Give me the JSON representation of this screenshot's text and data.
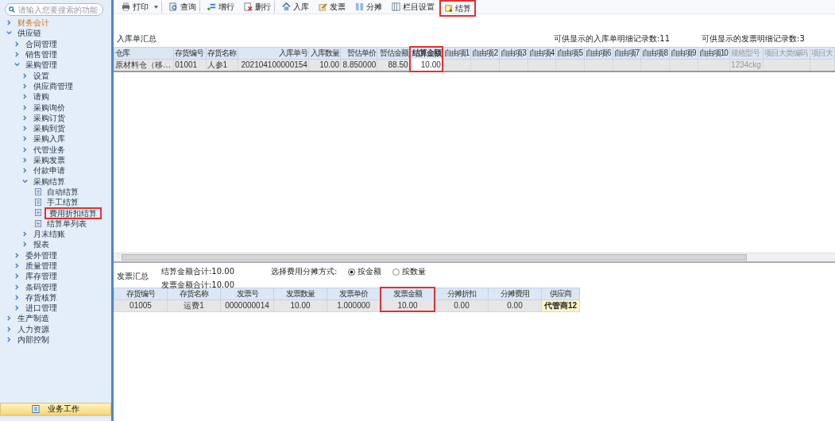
{
  "sidebar": {
    "search": {
      "placeholder": "请输入您要搜索的功能"
    },
    "tree": [
      {
        "label": "财务会计",
        "kind": "folder",
        "expanded": false,
        "emphasized": true,
        "highlighted": false
      },
      {
        "label": "供应链",
        "kind": "folder",
        "expanded": true,
        "emphasized": false,
        "highlighted": false,
        "children": [
          {
            "label": "合同管理",
            "kind": "folder",
            "expanded": false,
            "emphasized": false,
            "highlighted": false
          },
          {
            "label": "销售管理",
            "kind": "folder",
            "expanded": false,
            "emphasized": false,
            "highlighted": false
          },
          {
            "label": "采购管理",
            "kind": "folder",
            "expanded": true,
            "emphasized": false,
            "highlighted": false,
            "children": [
              {
                "label": "设置",
                "kind": "folder",
                "expanded": false,
                "emphasized": false,
                "highlighted": false
              },
              {
                "label": "供应商管理",
                "kind": "folder",
                "expanded": false,
                "emphasized": false,
                "highlighted": false
              },
              {
                "label": "请购",
                "kind": "folder",
                "expanded": false,
                "emphasized": false,
                "highlighted": false
              },
              {
                "label": "采购询价",
                "kind": "folder",
                "expanded": false,
                "emphasized": false,
                "highlighted": false
              },
              {
                "label": "采购订货",
                "kind": "folder",
                "expanded": false,
                "emphasized": false,
                "highlighted": false
              },
              {
                "label": "采购到货",
                "kind": "folder",
                "expanded": false,
                "emphasized": false,
                "highlighted": false
              },
              {
                "label": "采购入库",
                "kind": "folder",
                "expanded": false,
                "emphasized": false,
                "highlighted": false
              },
              {
                "label": "代管业务",
                "kind": "folder",
                "expanded": false,
                "emphasized": false,
                "highlighted": false
              },
              {
                "label": "采购发票",
                "kind": "folder",
                "expanded": false,
                "emphasized": false,
                "highlighted": false
              },
              {
                "label": "付款申请",
                "kind": "folder",
                "expanded": false,
                "emphasized": false,
                "highlighted": false
              },
              {
                "label": "采购结算",
                "kind": "folder",
                "expanded": true,
                "emphasized": false,
                "highlighted": false,
                "children": [
                  {
                    "label": "自动结算",
                    "kind": "page",
                    "emphasized": false,
                    "highlighted": false
                  },
                  {
                    "label": "手工结算",
                    "kind": "page",
                    "emphasized": false,
                    "highlighted": false
                  },
                  {
                    "label": "费用折扣结算",
                    "kind": "page",
                    "emphasized": false,
                    "highlighted": true
                  },
                  {
                    "label": "结算单列表",
                    "kind": "page",
                    "emphasized": false,
                    "highlighted": false
                  }
                ]
              },
              {
                "label": "月末结账",
                "kind": "folder",
                "expanded": false,
                "emphasized": false,
                "highlighted": false
              },
              {
                "label": "报表",
                "kind": "folder",
                "expanded": false,
                "emphasized": false,
                "highlighted": false
              }
            ]
          },
          {
            "label": "委外管理",
            "kind": "folder",
            "expanded": false,
            "emphasized": false,
            "highlighted": false
          },
          {
            "label": "质量管理",
            "kind": "folder",
            "expanded": false,
            "emphasized": false,
            "highlighted": false
          },
          {
            "label": "库存管理",
            "kind": "folder",
            "expanded": false,
            "emphasized": false,
            "highlighted": false
          },
          {
            "label": "条码管理",
            "kind": "folder",
            "expanded": false,
            "emphasized": false,
            "highlighted": false
          },
          {
            "label": "存货核算",
            "kind": "folder",
            "expanded": false,
            "emphasized": false,
            "highlighted": false
          },
          {
            "label": "进口管理",
            "kind": "folder",
            "expanded": false,
            "emphasized": false,
            "highlighted": false
          }
        ]
      },
      {
        "label": "生产制造",
        "kind": "folder",
        "expanded": false,
        "emphasized": false,
        "highlighted": false
      },
      {
        "label": "人力资源",
        "kind": "folder",
        "expanded": false,
        "emphasized": false,
        "highlighted": false
      },
      {
        "label": "内部控制",
        "kind": "folder",
        "expanded": false,
        "emphasized": false,
        "highlighted": false
      }
    ],
    "bottom_button": {
      "label": "业务工作",
      "selected": true
    }
  },
  "toolbar": [
    {
      "label": "打印",
      "dropdown": true,
      "separator_after": true,
      "highlighted": false
    },
    {
      "label": "查询",
      "dropdown": false,
      "separator_after": true,
      "highlighted": false
    },
    {
      "label": "增行",
      "dropdown": false,
      "separator_after": false,
      "highlighted": false
    },
    {
      "label": "删行",
      "dropdown": false,
      "separator_after": true,
      "highlighted": false
    },
    {
      "label": "入库",
      "dropdown": false,
      "separator_after": false,
      "highlighted": false
    },
    {
      "label": "发票",
      "dropdown": false,
      "separator_after": false,
      "highlighted": false
    },
    {
      "label": "分摊",
      "dropdown": false,
      "separator_after": false,
      "highlighted": false
    },
    {
      "label": "栏目设置",
      "dropdown": false,
      "separator_after": false,
      "highlighted": false
    },
    {
      "label": "结算",
      "dropdown": false,
      "separator_after": false,
      "highlighted": true
    }
  ],
  "receipt_summary": {
    "title": "入库单汇总",
    "receipt_count": "可供显示的入库单明细记录数:11",
    "invoice_count": "可供显示的发票明细记录数:3",
    "columns": [
      {
        "label": "仓库",
        "kind": "text",
        "highlighted": false,
        "muted": false
      },
      {
        "label": "存货编号",
        "kind": "text",
        "highlighted": false,
        "muted": false
      },
      {
        "label": "存货名称",
        "kind": "text",
        "highlighted": false,
        "muted": false
      },
      {
        "label": "入库单号",
        "kind": "number",
        "highlighted": false,
        "muted": false
      },
      {
        "label": "入库数量",
        "kind": "number",
        "highlighted": false,
        "muted": false
      },
      {
        "label": "暂估单价",
        "kind": "number",
        "highlighted": false,
        "muted": false
      },
      {
        "label": "暂估金额",
        "kind": "number",
        "highlighted": false,
        "muted": false
      },
      {
        "label": "结算金额",
        "kind": "editable",
        "highlighted": true,
        "muted": false
      },
      {
        "label": "自由项1",
        "kind": "text",
        "highlighted": false,
        "muted": false
      },
      {
        "label": "自由项2",
        "kind": "text",
        "highlighted": false,
        "muted": false
      },
      {
        "label": "自由项3",
        "kind": "text",
        "highlighted": false,
        "muted": false
      },
      {
        "label": "自由项4",
        "kind": "text",
        "highlighted": false,
        "muted": false
      },
      {
        "label": "自由项5",
        "kind": "text",
        "highlighted": false,
        "muted": false
      },
      {
        "label": "自由项6",
        "kind": "text",
        "highlighted": false,
        "muted": false
      },
      {
        "label": "自由项7",
        "kind": "text",
        "highlighted": false,
        "muted": false
      },
      {
        "label": "自由项8",
        "kind": "text",
        "highlighted": false,
        "muted": false
      },
      {
        "label": "自由项9",
        "kind": "text",
        "highlighted": false,
        "muted": false
      },
      {
        "label": "自由项10",
        "kind": "text",
        "highlighted": false,
        "muted": false
      },
      {
        "label": "规格型号",
        "kind": "text",
        "highlighted": false,
        "muted": true
      },
      {
        "label": "项目大类编码",
        "kind": "text",
        "highlighted": false,
        "muted": true
      },
      {
        "label": "项目大",
        "kind": "text",
        "highlighted": false,
        "muted": true
      }
    ],
    "rows": [
      [
        "原材料仓（移…",
        "01001",
        "人参1",
        "202104100000154",
        "10.00",
        "8.850000",
        "88.50",
        "10.00",
        "",
        "",
        "",
        "",
        "",
        "",
        "",
        "",
        "",
        "",
        "1234ckg",
        "",
        ""
      ]
    ]
  },
  "invoice_summary": {
    "title": "发票汇总",
    "settle_total": "结算金额合计:10.00",
    "invoice_total": "发票金额合计:10.00",
    "method_label": "选择费用分摊方式:",
    "methods": [
      {
        "label": "按金额",
        "selected": true
      },
      {
        "label": "按数量",
        "selected": false
      }
    ],
    "columns": [
      {
        "label": "存货编号",
        "highlighted": false
      },
      {
        "label": "存货名称",
        "highlighted": false
      },
      {
        "label": "发票号",
        "highlighted": false
      },
      {
        "label": "发票数量",
        "highlighted": false
      },
      {
        "label": "发票单价",
        "highlighted": false
      },
      {
        "label": "发票金额",
        "highlighted": true
      },
      {
        "label": "分摊折扣",
        "highlighted": false
      },
      {
        "label": "分摊费用",
        "highlighted": false
      },
      {
        "label": "供应商",
        "highlighted": false
      }
    ],
    "rows": [
      [
        "01005",
        "运费1",
        "0000000014",
        "10.00",
        "1.000000",
        "10.00",
        "0.00",
        "0.00",
        "代管商12"
      ]
    ]
  }
}
